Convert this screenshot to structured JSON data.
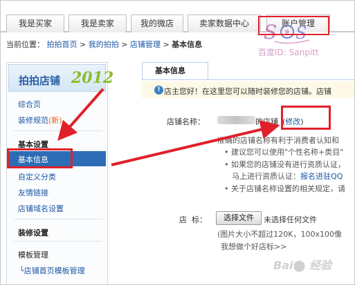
{
  "top_tabs": [
    "我是买家",
    "我是卖家",
    "我的微店",
    "卖家数据中心",
    "账户管理"
  ],
  "breadcrumb": {
    "prefix": "当前位置：",
    "items": [
      "拍拍首页",
      "我的拍拍",
      "店铺管理"
    ],
    "separator": ">",
    "current": "基本信息"
  },
  "watermark": {
    "text": "百度ID: Sanpitt"
  },
  "sidebar": {
    "logo_text": "拍拍店铺",
    "logo_year": "2012",
    "items_top": [
      {
        "label": "综合页"
      },
      {
        "label": "装修规范",
        "badge": "(新)"
      }
    ],
    "section_basic": "基本设置",
    "basic_items": [
      "基本信息",
      "自定义分类",
      "友情链接",
      "店铺域名设置"
    ],
    "section_decor": "装修设置",
    "section_template": "模板管理",
    "template_items": [
      "店铺首页模板管理"
    ]
  },
  "main": {
    "tab_title": "基本信息",
    "notice": "店主您好！在这里您可以随时装修您的店铺。店铺",
    "shop_name_label": "店铺名称：",
    "shop_name_suffix": "的店铺",
    "modify_link": "修改",
    "desc_lines": [
      "准确的店铺名称有利于消费者认知和",
      "• 建议您可以使用\"个性名称+类目\"",
      "• 如果您的店铺没有进行资质认证，",
      "马上进行资质认证：",
      "报名进驻QQ",
      "• 关于店铺名称设置的相关规定，请"
    ],
    "logo_label": "店  标：",
    "choose_file": "选择文件",
    "no_file": "未选择任何文件",
    "size_hint": "(图片大小不超过120K，100x100像",
    "good_logo_link": "我想做个好店标>>"
  },
  "colors": {
    "accent": "#2d6db5",
    "highlight": "#e0202a",
    "link": "#1a56a5"
  }
}
